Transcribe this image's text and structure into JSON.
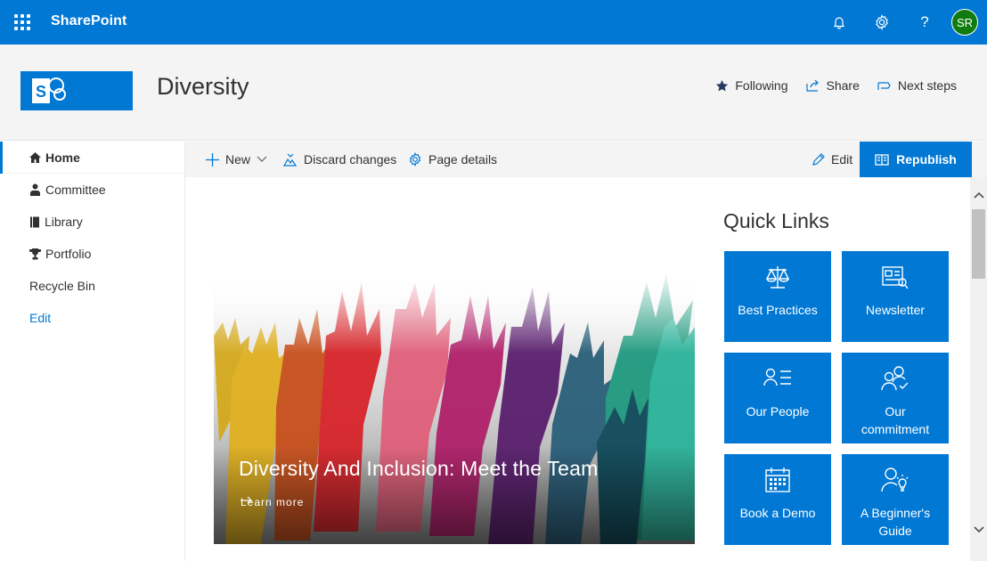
{
  "suitebar": {
    "brand": "SharePoint",
    "user_initials": "SR",
    "help_glyph": "?"
  },
  "site": {
    "logo_letter": "S",
    "title": "Diversity",
    "actions": [
      {
        "label": "Following",
        "icon": "star-icon"
      },
      {
        "label": "Share",
        "icon": "share-icon"
      },
      {
        "label": "Next steps",
        "icon": "flag-icon"
      }
    ]
  },
  "nav": {
    "items": [
      {
        "label": "Home",
        "icon": "home-icon"
      },
      {
        "label": "Committee",
        "icon": "person-icon"
      },
      {
        "label": "Library",
        "icon": "book-icon"
      },
      {
        "label": "Portfolio",
        "icon": "trophy-icon"
      },
      {
        "label": "Recycle Bin",
        "icon": ""
      },
      {
        "label": "Edit",
        "icon": ""
      }
    ]
  },
  "commandbar": {
    "new_label": "New",
    "discard_label": "Discard changes",
    "page_details_label": "Page details",
    "edit_label": "Edit",
    "republish_label": "Republish"
  },
  "hero": {
    "title": "Diversity And Inclusion: Meet the Team",
    "link_label": "Learn more"
  },
  "quicklinks": {
    "title": "Quick Links",
    "tiles": [
      {
        "lines": [
          "Best Practices"
        ],
        "icon": "scales-icon"
      },
      {
        "lines": [
          "Newsletter"
        ],
        "icon": "newspaper-icon"
      },
      {
        "lines": [
          "Our People"
        ],
        "icon": "people-list-icon"
      },
      {
        "lines": [
          "Our",
          "commitment"
        ],
        "icon": "people-check-icon"
      },
      {
        "lines": [
          "Book a Demo"
        ],
        "icon": "calendar-icon"
      },
      {
        "lines": [
          "A Beginner's",
          "Guide"
        ],
        "icon": "person-idea-icon"
      }
    ]
  },
  "colors": {
    "brand_blue": "#0078d4",
    "avatar_green": "#107c10",
    "header_gray": "#f4f4f4"
  }
}
